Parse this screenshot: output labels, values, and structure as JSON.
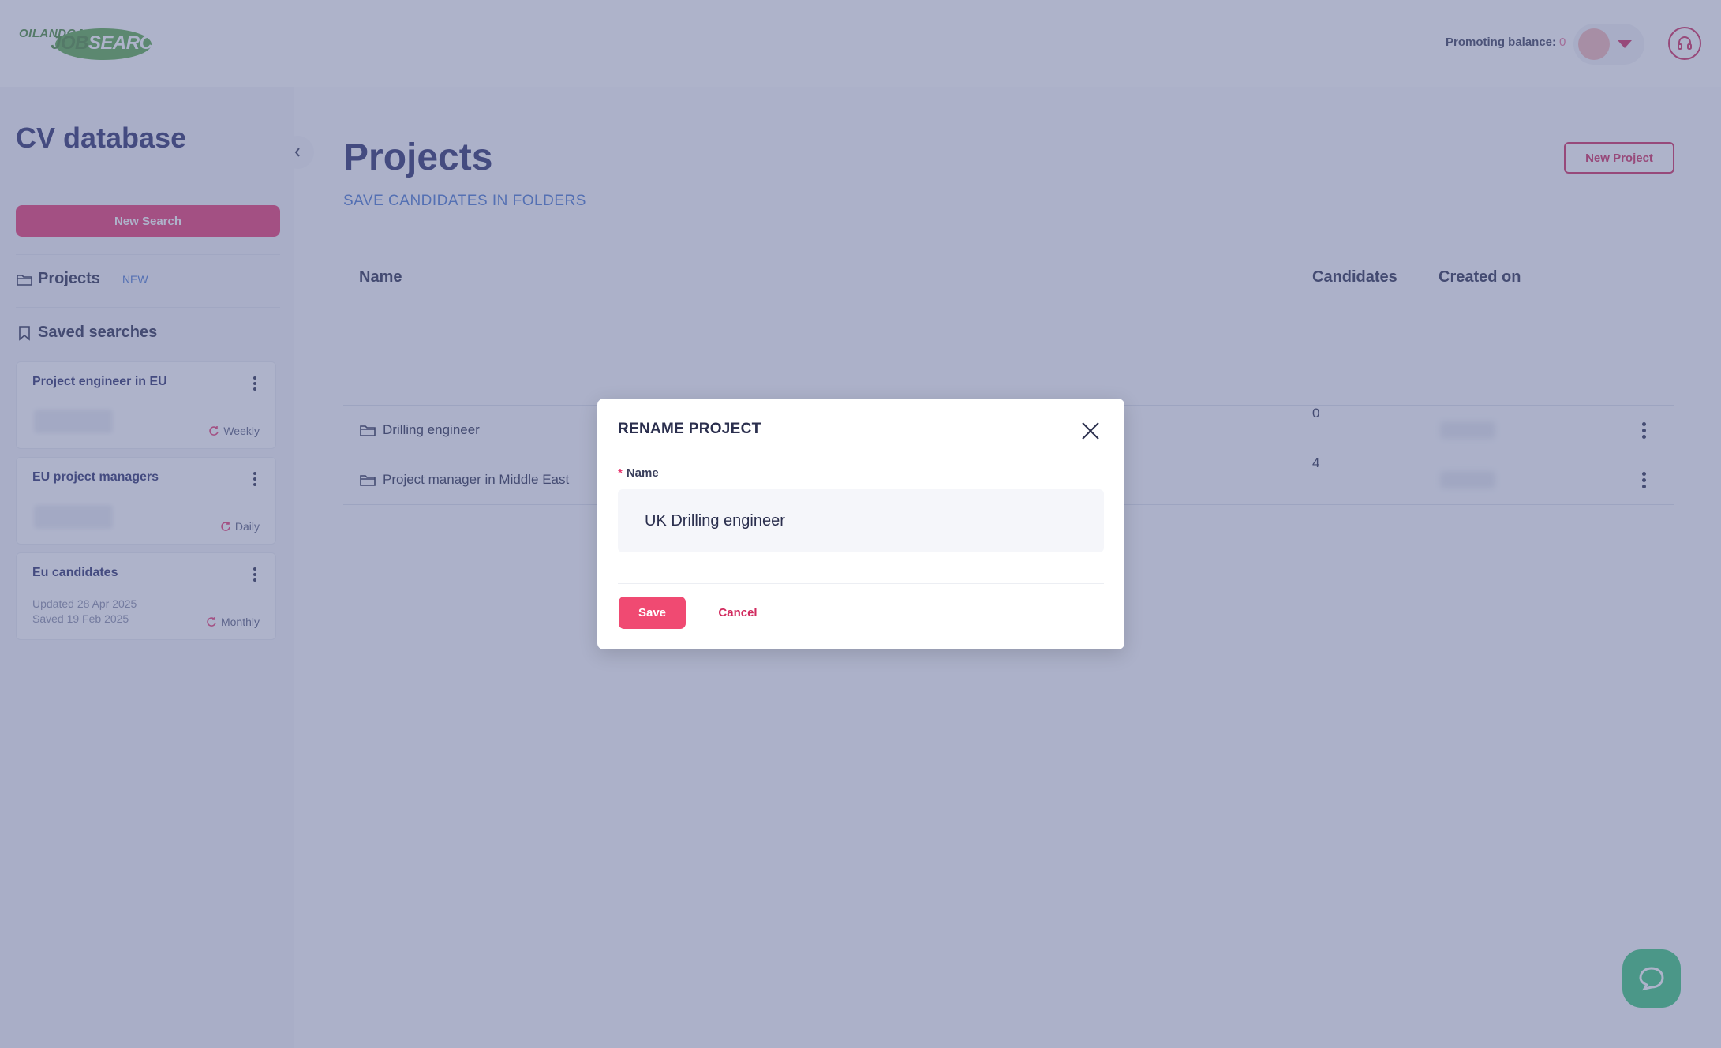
{
  "header": {
    "logo_small": "OILANDGAS",
    "logo_job": "JOB",
    "logo_search": "SEARCH",
    "promo_label": "Promoting balance:",
    "promo_value": "0"
  },
  "sidebar": {
    "title": "CV database",
    "new_search_label": "New Search",
    "projects_label": "Projects",
    "projects_badge": "NEW",
    "saved_searches_label": "Saved searches",
    "saved_searches": [
      {
        "name": "Project engineer in EU",
        "frequency": "Weekly"
      },
      {
        "name": "EU project managers",
        "frequency": "Daily"
      },
      {
        "name": "Eu candidates",
        "frequency": "Monthly",
        "updated_label": "Updated",
        "updated": "28 Apr 2025",
        "saved_label": "Saved",
        "saved": "19 Feb 2025"
      }
    ]
  },
  "main": {
    "title": "Projects",
    "subtitle": "SAVE CANDIDATES IN FOLDERS",
    "new_project_label": "New Project",
    "table": {
      "columns": [
        "Name",
        "Candidates",
        "Created on"
      ],
      "rows": [
        {
          "name": "Drilling engineer",
          "candidates": "0"
        },
        {
          "name": "Project manager in Middle East",
          "candidates": "4"
        }
      ]
    }
  },
  "modal": {
    "title": "RENAME PROJECT",
    "field_label": "Name",
    "required_mark": "*",
    "name_value": "UK Drilling engineer",
    "save_label": "Save",
    "cancel_label": "Cancel"
  },
  "colors": {
    "accent": "#e83870",
    "brand_navy": "#2b2f6b",
    "chat_green": "#38c77a",
    "overlay": "rgba(94,103,150,0.5)"
  },
  "icons": [
    "chevron-left-icon",
    "folder-icon",
    "bookmark-icon",
    "refresh-icon",
    "kebab-menu-icon",
    "close-icon",
    "headset-icon",
    "chat-icon",
    "caret-down-icon"
  ]
}
